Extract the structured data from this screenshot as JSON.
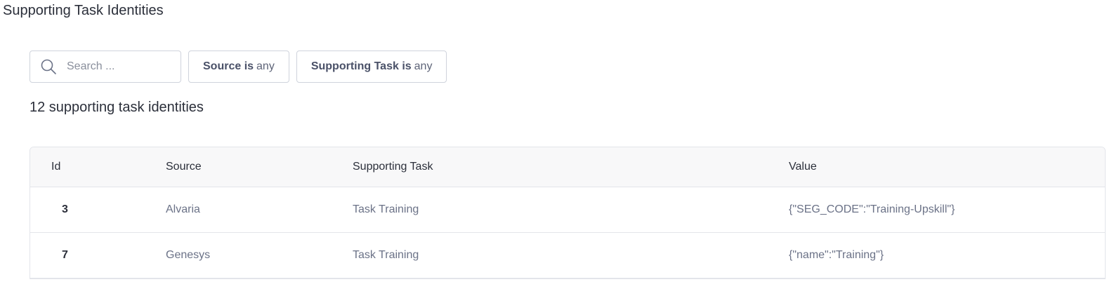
{
  "page": {
    "title": "Supporting Task Identities"
  },
  "search": {
    "placeholder": "Search ..."
  },
  "filters": {
    "source": {
      "label": "Source is",
      "value": "any"
    },
    "supporting_task": {
      "label": "Supporting Task is",
      "value": "any"
    }
  },
  "summary": {
    "count_text": "12 supporting task identities"
  },
  "table": {
    "headers": {
      "id": "Id",
      "source": "Source",
      "supporting_task": "Supporting Task",
      "value": "Value"
    },
    "rows": [
      {
        "id": "3",
        "source": "Alvaria",
        "supporting_task": "Task Training",
        "value": "{\"SEG_CODE\":\"Training-Upskill\"}"
      },
      {
        "id": "7",
        "source": "Genesys",
        "supporting_task": "Task Training",
        "value": "{\"name\":\"Training\"}"
      }
    ]
  },
  "icons": {
    "search": "search-icon"
  },
  "colors": {
    "text_primary": "#2b2f3a",
    "text_secondary": "#6b7287",
    "border": "#cfd3dc",
    "header_bg": "#f8f8f9"
  }
}
